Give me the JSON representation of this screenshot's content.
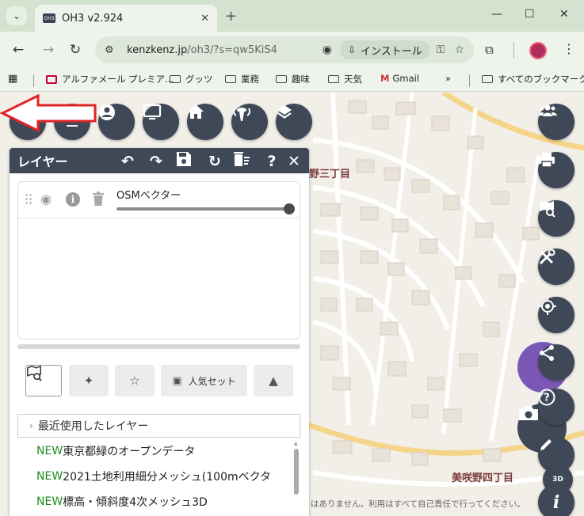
{
  "browser": {
    "tab_title": "OH3 v2.924",
    "tab_favicon_text": "OH3",
    "url_host": "kenzkenz.jp",
    "url_path": "/oh3/?s=qw5KiS4",
    "install_label": "インストール"
  },
  "bookmarks": [
    {
      "label": "アルファメール プレミア...",
      "icon": "alfa-icon"
    },
    {
      "label": "グッツ",
      "icon": "folder-icon"
    },
    {
      "label": "業務",
      "icon": "folder-icon"
    },
    {
      "label": "趣味",
      "icon": "folder-icon"
    },
    {
      "label": "天気",
      "icon": "folder-icon"
    },
    {
      "label": "Gmail",
      "icon": "gmail-icon"
    },
    {
      "label": "すべてのブックマーク",
      "icon": "folder-icon"
    }
  ],
  "bookmarks_overflow": "»",
  "map": {
    "label_top": "野三丁目",
    "label_bottom": "美咲野四丁目",
    "footer_text": "はありません。利用はすべて自己責任で行ってください。"
  },
  "panel": {
    "title": "レイヤー",
    "help": "?",
    "close": "✕",
    "layer": {
      "name": "OSMベクター",
      "opacity": 1.0
    },
    "buttons": {
      "popular_set": "人気セット"
    },
    "recent_label": "最近使用したレイヤー",
    "items": [
      {
        "prefix": "NEW",
        "text": "東京都緑のオープンデータ"
      },
      {
        "prefix": "NEW",
        "text": "2021土地利用細分メッシュ(100mベクタ"
      },
      {
        "prefix": "NEW",
        "text": "標高・傾斜度4次メッシュ3D"
      }
    ]
  },
  "colors": {
    "button_bg": "#3f4857",
    "new_label": "#1f8a1f",
    "arrow": "#e02424",
    "fab_purple": "#7b58b6"
  },
  "right_button_3d": "3D",
  "right_button_info": "i"
}
